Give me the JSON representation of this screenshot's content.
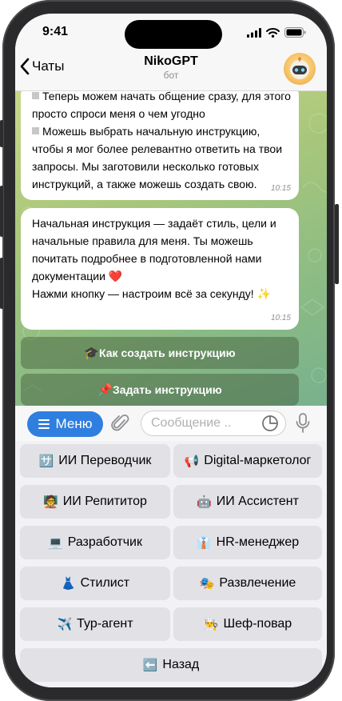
{
  "status_bar": {
    "time": "9:41"
  },
  "header": {
    "back_label": "Чаты",
    "title": "NikoGPT",
    "subtitle": "бот"
  },
  "messages": [
    {
      "lines": [
        {
          "marker": true,
          "text": "Теперь можем начать общение сразу, для этого"
        },
        {
          "marker": false,
          "text": "просто спроси меня о чем угодно"
        },
        {
          "marker": true,
          "text": "Можешь выбрать начальную инструкцию,"
        },
        {
          "marker": false,
          "text": "чтобы я мог более релевантно ответить на твои"
        },
        {
          "marker": false,
          "text": "запросы. Мы заготовили несколько готовых"
        },
        {
          "marker": false,
          "text": "инструкций, а также можешь создать свою."
        }
      ],
      "time": "10:15"
    },
    {
      "lines": [
        {
          "marker": false,
          "text": "Начальная инструкция — задаёт стиль, цели и"
        },
        {
          "marker": false,
          "text": "начальные правила для меня. Ты можешь"
        },
        {
          "marker": false,
          "text": "почитать подробнее в подготовленной нами"
        },
        {
          "marker": false,
          "text": "документации ❤️"
        },
        {
          "marker": false,
          "text": "Нажми кнопку — настроим всё за секунду! ✨"
        }
      ],
      "time": "10:15"
    }
  ],
  "inline_buttons": [
    {
      "icon": "🎓",
      "label": "Как создать инструкцию"
    },
    {
      "icon": "📌",
      "label": "Задать инструкцию"
    }
  ],
  "input_bar": {
    "menu_label": "Меню",
    "placeholder": "Сообщение .."
  },
  "keyboard": [
    {
      "icon": "🈂️",
      "label": "ИИ Переводчик"
    },
    {
      "icon": "📢",
      "label": "Digital-маркетолог"
    },
    {
      "icon": "🧑‍🏫",
      "label": "ИИ Репититор"
    },
    {
      "icon": "🤖",
      "label": "ИИ Ассистент"
    },
    {
      "icon": "💻",
      "label": "Разработчик"
    },
    {
      "icon": "👔",
      "label": "HR-менеджер"
    },
    {
      "icon": "👗",
      "label": "Стилист"
    },
    {
      "icon": "🎭",
      "label": "Развлечение"
    },
    {
      "icon": "✈️",
      "label": "Тур-агент"
    },
    {
      "icon": "👨‍🍳",
      "label": "Шеф-повар"
    },
    {
      "icon": "⬅️",
      "label": "Назад"
    }
  ],
  "colors": {
    "accent": "#2f7fe0",
    "bubble": "#ffffff",
    "chat_bg_start": "#c9d78a",
    "chat_bg_end": "#78b18c"
  }
}
